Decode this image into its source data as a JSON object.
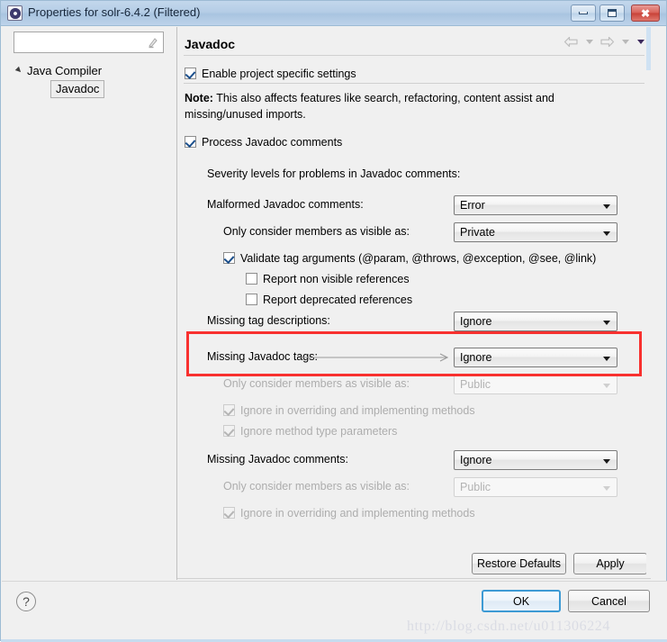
{
  "window": {
    "title": "Properties for solr-6.4.2 (Filtered)",
    "icon": "eclipse-properties-icon",
    "controls": {
      "minimize": "–",
      "maximize": "□",
      "close": "✕"
    }
  },
  "sidebar": {
    "filter": {
      "value": "",
      "placeholder": "",
      "clear_icon": "clear-filter-icon"
    },
    "tree": [
      {
        "label": "Java Compiler",
        "expanded": true,
        "selected": false
      },
      {
        "label": "Javadoc",
        "expanded": false,
        "selected": true
      }
    ]
  },
  "header": {
    "title": "Javadoc",
    "nav": {
      "back_icon": "back-arrow-icon",
      "back_caret_icon": "chevron-down-icon",
      "forward_icon": "forward-arrow-icon",
      "forward_caret_icon": "chevron-down-icon",
      "menu_caret_icon": "chevron-down-icon"
    }
  },
  "main": {
    "enable_project_specific": {
      "label": "Enable project specific settings",
      "checked": true
    },
    "note_bold": "Note:",
    "note_text": " This also affects features like search, refactoring, content assist and missing/unused imports.",
    "process_javadoc": {
      "label": "Process Javadoc comments",
      "checked": true
    },
    "severity_heading": "Severity levels for problems in Javadoc comments:",
    "rows": {
      "malformed_label": "Malformed Javadoc comments:",
      "malformed_value": "Error",
      "malformed_visible_label": "Only consider members as visible as:",
      "malformed_visible_value": "Private",
      "validate_tags_label": "Validate tag arguments (@param, @throws, @exception, @see, @link)",
      "validate_tags_checked": true,
      "report_non_visible_label": "Report non visible references",
      "report_non_visible_checked": false,
      "report_deprecated_label": "Report deprecated references",
      "report_deprecated_checked": false,
      "missing_tag_desc_label": "Missing tag descriptions:",
      "missing_tag_desc_value": "Ignore",
      "missing_javadoc_tags_label": "Missing Javadoc tags:",
      "missing_javadoc_tags_value": "Ignore",
      "tags_visible_label": "Only consider members as visible as:",
      "tags_visible_value": "Public",
      "tags_ignore_override_label": "Ignore in overriding and implementing methods",
      "tags_ignore_override_checked": true,
      "tags_ignore_typeparams_label": "Ignore method type parameters",
      "tags_ignore_typeparams_checked": true,
      "missing_javadoc_comments_label": "Missing Javadoc comments:",
      "missing_javadoc_comments_value": "Ignore",
      "comments_visible_label": "Only consider members as visible as:",
      "comments_visible_value": "Public",
      "comments_ignore_override_label": "Ignore in overriding and implementing methods",
      "comments_ignore_override_checked": true
    },
    "restore_defaults_label": "Restore Defaults",
    "apply_label": "Apply"
  },
  "footer": {
    "help_icon": "question-mark-icon",
    "ok_label": "OK",
    "cancel_label": "Cancel"
  },
  "annotation": {
    "highlight_color": "#f8312f",
    "arrow_icon": "pointer-arrow-icon"
  },
  "watermark": "http://blog.csdn.net/u011306224"
}
